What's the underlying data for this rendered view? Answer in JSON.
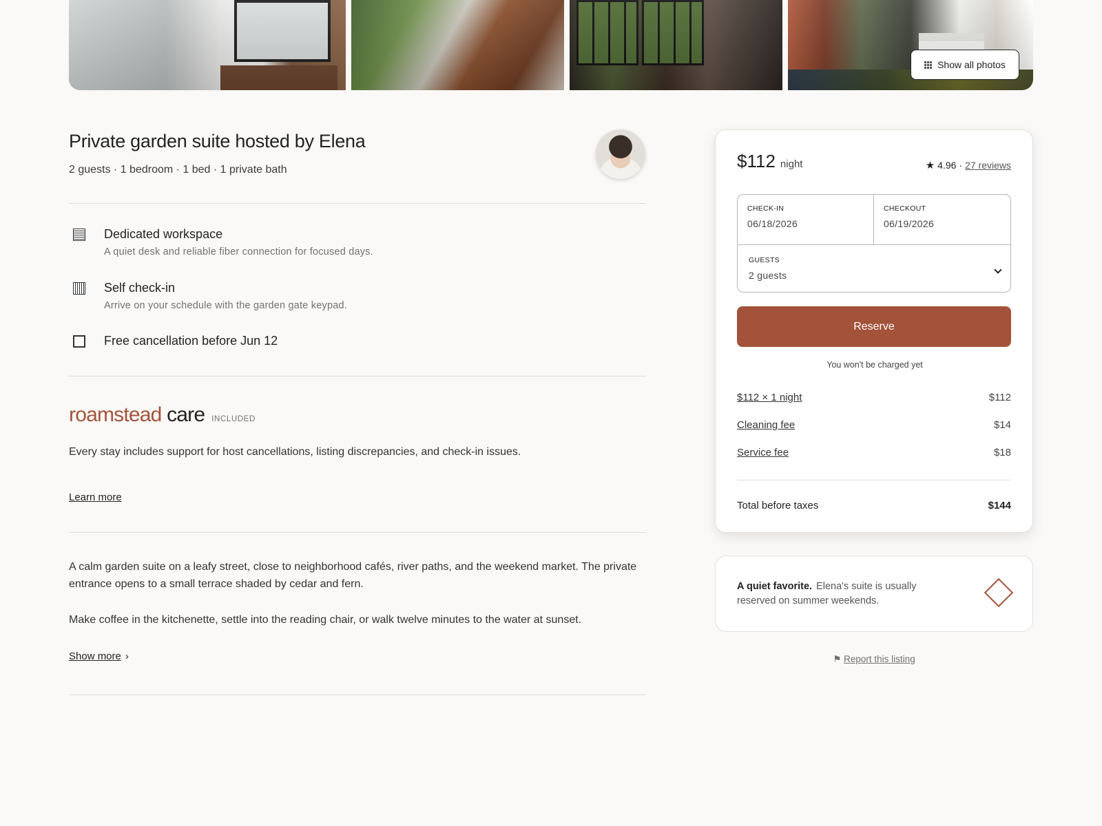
{
  "gallery": {
    "show_all_label": "Show all photos"
  },
  "listing": {
    "title": "Private garden suite hosted by Elena",
    "subtitle": "2 guests · 1 bedroom · 1 bed · 1 private bath"
  },
  "features": [
    {
      "icon": "workspace-icon",
      "title": "Dedicated workspace",
      "description": "A quiet desk and reliable fiber connection for focused days."
    },
    {
      "icon": "check-in-icon",
      "title": "Self check-in",
      "description": "Arrive on your schedule with the garden gate keypad."
    },
    {
      "icon": "calendar-icon",
      "title": "Free cancellation before Jun 12",
      "description": ""
    }
  ],
  "care": {
    "brand_part1": "roamstead",
    "brand_part2": "care",
    "badge": "INCLUDED",
    "text": "Every stay includes support for host cancellations, listing discrepancies, and check-in issues.",
    "learn_more": "Learn more"
  },
  "description": {
    "para1": "A calm garden suite on a leafy street, close to neighborhood cafés, river paths, and the weekend market. The private entrance opens to a small terrace shaded by cedar and fern.",
    "para2": "Make coffee in the kitchenette, settle into the reading chair, or walk twelve minutes to the water at sunset.",
    "show_more": "Show more",
    "show_more_chevron": "›"
  },
  "booking": {
    "price": "$112",
    "price_unit": "night",
    "rating_star": "★",
    "rating": "4.96",
    "rating_sep": "·",
    "reviews": "27 reviews",
    "checkin_label": "CHECK-IN",
    "checkin_value": "06/18/2026",
    "checkout_label": "CHECKOUT",
    "checkout_value": "06/19/2026",
    "guests_label": "GUESTS",
    "guests_value": "2 guests",
    "reserve_label": "Reserve",
    "no_charge_note": "You won't be charged yet",
    "line_items": [
      {
        "label": "$112 × 1 night",
        "amount": "$112"
      },
      {
        "label": "Cleaning fee",
        "amount": "$14"
      },
      {
        "label": "Service fee",
        "amount": "$18"
      }
    ],
    "total_label": "Total before taxes",
    "total_amount": "$144"
  },
  "favorite": {
    "bold": "A quiet favorite.",
    "text": "Elena's suite is usually reserved on summer weekends."
  },
  "report": {
    "flag": "⚑",
    "label": "Report this listing"
  },
  "colors": {
    "accent": "#a3533a",
    "background": "#faf9f7"
  }
}
